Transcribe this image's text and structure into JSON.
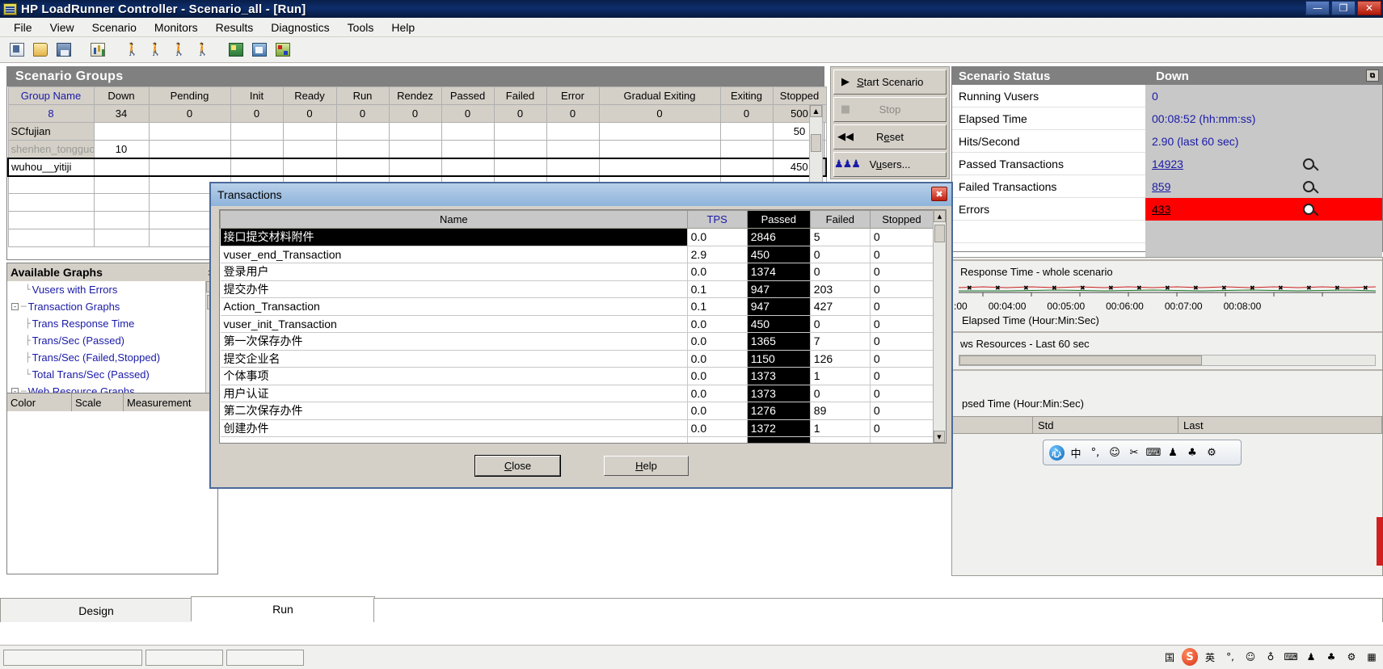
{
  "window": {
    "title": "HP LoadRunner Controller - Scenario_all - [Run]",
    "icon": "loadrunner-icon",
    "buttons": {
      "minimize": "—",
      "maximize": "❐",
      "close": "✕"
    }
  },
  "menubar": {
    "items": [
      "File",
      "View",
      "Scenario",
      "Monitors",
      "Results",
      "Diagnostics",
      "Tools",
      "Help"
    ]
  },
  "toolbar": {
    "items": [
      {
        "name": "new-scenario-icon"
      },
      {
        "name": "open-scenario-icon"
      },
      {
        "name": "save-scenario-icon"
      },
      {
        "name": "report-icon"
      },
      {
        "name": "run-vuser-icon"
      },
      {
        "name": "run-vuser-2-icon"
      },
      {
        "name": "stop-vuser-icon"
      },
      {
        "name": "stop-vuser-2-icon"
      },
      {
        "name": "view-graph-icon"
      },
      {
        "name": "analysis-icon"
      },
      {
        "name": "results-icon"
      }
    ]
  },
  "scenario_groups": {
    "title": "Scenario Groups",
    "columns": [
      "Group Name",
      "Down",
      "Pending",
      "Init",
      "Ready",
      "Run",
      "Rendez",
      "Passed",
      "Failed",
      "Error",
      "Gradual Exiting",
      "Exiting",
      "Stopped"
    ],
    "totals": [
      "8",
      "34",
      "0",
      "0",
      "0",
      "0",
      "0",
      "0",
      "0",
      "0",
      "0",
      "0",
      "500"
    ],
    "rows": [
      {
        "name": "SCfujian",
        "cells": [
          "",
          "",
          "",
          "",
          "",
          "",
          "",
          "",
          "",
          "",
          "",
          "50"
        ],
        "selected": false,
        "dim": false
      },
      {
        "name": "shenhen_tongguo",
        "cells": [
          "10",
          "",
          "",
          "",
          "",
          "",
          "",
          "",
          "",
          "",
          "",
          ""
        ],
        "selected": false,
        "dim": true
      },
      {
        "name": "wuhou__yitiji",
        "cells": [
          "",
          "",
          "",
          "",
          "",
          "",
          "",
          "",
          "",
          "",
          "",
          "450"
        ],
        "selected": true,
        "dim": false
      },
      {
        "name": "",
        "cells": [
          "",
          "",
          "",
          "",
          "",
          "",
          "",
          "",
          "",
          "",
          "",
          ""
        ],
        "selected": false,
        "dim": false
      },
      {
        "name": "",
        "cells": [
          "",
          "",
          "",
          "",
          "",
          "",
          "",
          "",
          "",
          "",
          "",
          ""
        ],
        "selected": false,
        "dim": false
      },
      {
        "name": "",
        "cells": [
          "",
          "",
          "",
          "",
          "",
          "",
          "",
          "",
          "",
          "",
          "",
          ""
        ],
        "selected": false,
        "dim": false
      },
      {
        "name": "",
        "cells": [
          "",
          "",
          "",
          "",
          "",
          "",
          "",
          "",
          "",
          "",
          "",
          ""
        ],
        "selected": false,
        "dim": false
      }
    ]
  },
  "controls": {
    "start": "Start Scenario",
    "start_underline": "S",
    "stop": "Stop",
    "reset": "Reset",
    "vusers": "Vusers...",
    "icons": {
      "start": "play-icon",
      "stop": "stop-icon",
      "reset": "rewind-icon",
      "vusers": "vusers-icon"
    }
  },
  "available_graphs": {
    "title": "Available Graphs",
    "close": "×",
    "nodes": [
      {
        "label": "Vusers with Errors",
        "indent": 2,
        "expander": "",
        "leaf": true
      },
      {
        "label": "Transaction Graphs",
        "indent": 0,
        "expander": "-",
        "leaf": false
      },
      {
        "label": "Trans Response Time",
        "indent": 2,
        "expander": "",
        "leaf": true
      },
      {
        "label": "Trans/Sec (Passed)",
        "indent": 2,
        "expander": "",
        "leaf": true
      },
      {
        "label": "Trans/Sec (Failed,Stopped)",
        "indent": 2,
        "expander": "",
        "leaf": true
      },
      {
        "label": "Total Trans/Sec (Passed)",
        "indent": 2,
        "expander": "",
        "leaf": true
      },
      {
        "label": "Web Resource Graphs",
        "indent": 0,
        "expander": "-",
        "leaf": false
      }
    ]
  },
  "legend": {
    "columns": [
      "Color",
      "Scale",
      "Measurement"
    ]
  },
  "scenario_status": {
    "title": "Scenario Status",
    "col2": "Down",
    "restore_icon": "restore-icon",
    "rows": [
      {
        "label": "Running Vusers",
        "value": "0",
        "style": "plain",
        "magnifier": false
      },
      {
        "label": "Elapsed Time",
        "value": "00:08:52 (hh:mm:ss)",
        "style": "plain",
        "magnifier": false
      },
      {
        "label": "Hits/Second",
        "value": "2.90 (last 60 sec)",
        "style": "plain",
        "magnifier": false
      },
      {
        "label": "Passed Transactions",
        "value": "14923",
        "style": "link",
        "magnifier": true
      },
      {
        "label": "Failed Transactions",
        "value": "859",
        "style": "link",
        "magnifier": true
      },
      {
        "label": "Errors",
        "value": "433",
        "style": "error",
        "magnifier": true
      }
    ]
  },
  "graphs": [
    {
      "title": "Response Time - whole scenario",
      "x_ticks": [
        ":00",
        "00:04:00",
        "00:05:00",
        "00:06:00",
        "00:07:00",
        "00:08:00"
      ],
      "axis_label": "Elapsed Time (Hour:Min:Sec)"
    },
    {
      "title": "ws Resources - Last 60 sec",
      "x_ticks": [],
      "axis_label": "psed Time (Hour:Min:Sec)"
    }
  ],
  "graph_legend": {
    "columns": [
      "",
      "Std",
      "Last"
    ]
  },
  "transactions_dialog": {
    "title": "Transactions",
    "close_icon": "close-icon",
    "columns": [
      "Name",
      "TPS",
      "Passed",
      "Failed",
      "Stopped"
    ],
    "rows": [
      {
        "name": "接口提交材料附件",
        "tps": "0.0",
        "passed": "2846",
        "failed": "5",
        "stopped": "0",
        "selected": true
      },
      {
        "name": "vuser_end_Transaction",
        "tps": "2.9",
        "passed": "450",
        "failed": "0",
        "stopped": "0",
        "selected": false
      },
      {
        "name": "登录用户",
        "tps": "0.0",
        "passed": "1374",
        "failed": "0",
        "stopped": "0",
        "selected": false
      },
      {
        "name": "提交办件",
        "tps": "0.1",
        "passed": "947",
        "failed": "203",
        "stopped": "0",
        "selected": false
      },
      {
        "name": "Action_Transaction",
        "tps": "0.1",
        "passed": "947",
        "failed": "427",
        "stopped": "0",
        "selected": false
      },
      {
        "name": "vuser_init_Transaction",
        "tps": "0.0",
        "passed": "450",
        "failed": "0",
        "stopped": "0",
        "selected": false
      },
      {
        "name": "第一次保存办件",
        "tps": "0.0",
        "passed": "1365",
        "failed": "7",
        "stopped": "0",
        "selected": false
      },
      {
        "name": "提交企业名",
        "tps": "0.0",
        "passed": "1150",
        "failed": "126",
        "stopped": "0",
        "selected": false
      },
      {
        "name": "个体事项",
        "tps": "0.0",
        "passed": "1373",
        "failed": "1",
        "stopped": "0",
        "selected": false
      },
      {
        "name": "用户认证",
        "tps": "0.0",
        "passed": "1373",
        "failed": "0",
        "stopped": "0",
        "selected": false
      },
      {
        "name": "第二次保存办件",
        "tps": "0.0",
        "passed": "1276",
        "failed": "89",
        "stopped": "0",
        "selected": false
      },
      {
        "name": "创建办件",
        "tps": "0.0",
        "passed": "1372",
        "failed": "1",
        "stopped": "0",
        "selected": false
      },
      {
        "name": "",
        "tps": "",
        "passed": "",
        "failed": "",
        "stopped": "",
        "selected": false
      }
    ],
    "buttons": {
      "close": "Close",
      "help": "Help"
    }
  },
  "bottom_tabs": {
    "design": "Design",
    "run": "Run"
  },
  "ime": {
    "items": [
      {
        "name": "ime-logo-icon",
        "glyph": "心"
      },
      {
        "name": "ime-chinese-icon",
        "glyph": "中"
      },
      {
        "name": "ime-halfwidth-icon",
        "glyph": "°,"
      },
      {
        "name": "ime-emoji-icon",
        "glyph": "☺"
      },
      {
        "name": "ime-tools-icon",
        "glyph": "✂"
      },
      {
        "name": "ime-keyboard-icon",
        "glyph": "⌨"
      },
      {
        "name": "ime-user-icon",
        "glyph": "♟"
      },
      {
        "name": "ime-hat-icon",
        "glyph": "♣"
      },
      {
        "name": "ime-settings-icon",
        "glyph": "⚙"
      }
    ]
  },
  "tray": {
    "items": [
      {
        "name": "tray-ime-icon",
        "glyph": "国"
      },
      {
        "name": "tray-sogou-icon",
        "glyph": "S"
      },
      {
        "name": "tray-chinese-icon",
        "glyph": "英"
      },
      {
        "name": "tray-halfwidth-icon",
        "glyph": "°,"
      },
      {
        "name": "tray-emoji-icon",
        "glyph": "☺"
      },
      {
        "name": "tray-mic-icon",
        "glyph": "♁"
      },
      {
        "name": "tray-keyboard-icon",
        "glyph": "⌨"
      },
      {
        "name": "tray-user-icon",
        "glyph": "♟"
      },
      {
        "name": "tray-hat-icon",
        "glyph": "♣"
      },
      {
        "name": "tray-settings-icon",
        "glyph": "⚙"
      },
      {
        "name": "tray-grid-icon",
        "glyph": "▦"
      }
    ]
  }
}
